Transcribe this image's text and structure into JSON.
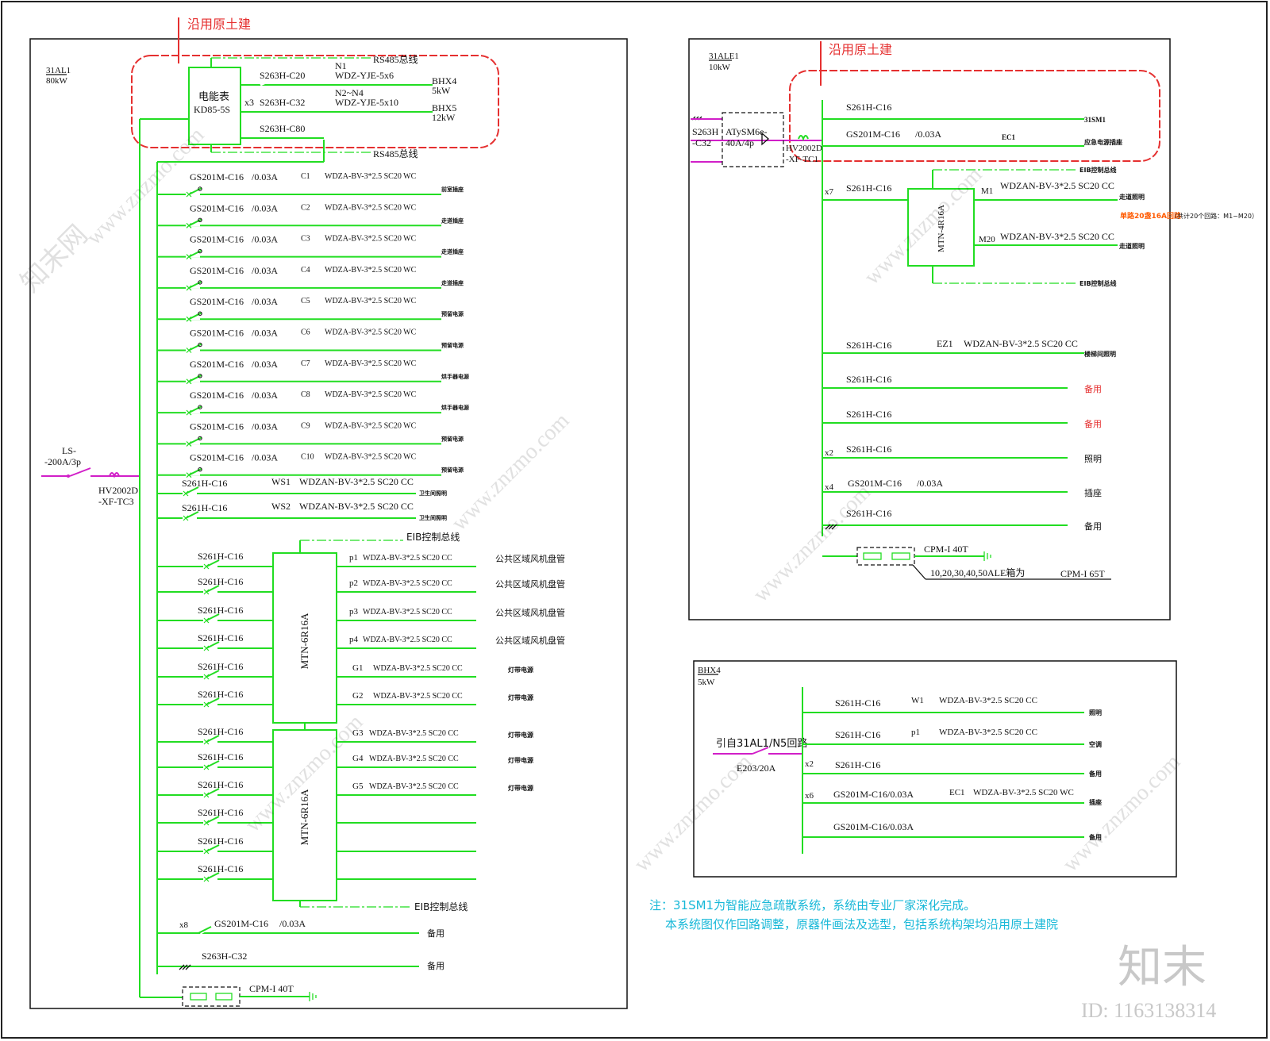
{
  "colors": {
    "bus": "#22dd22",
    "incoming": "#d11fc8",
    "cloud": "#e53030",
    "note": "#18b8d8",
    "orange": "#ff5a00"
  },
  "common": {
    "bus_left": "沿用原土建",
    "spare": "备用"
  },
  "panel1": {
    "name": "31AL1",
    "power": "80kW",
    "meter": "电能表",
    "meter_model": "KD85-5S",
    "x3": "x3",
    "rs485": "RS485总线",
    "top_circuits": [
      {
        "breaker": "S263H-C20",
        "id": "N1",
        "cable": "WDZ-YJE-5x6",
        "dest": "BHX4",
        "dest_kw": "5kW"
      },
      {
        "breaker": "S263H-C32",
        "id": "N2~N4",
        "cable": "WDZ-YJE-5x10",
        "dest": "BHX5",
        "dest_kw": "12kW"
      },
      {
        "breaker": "S263H-C80"
      }
    ],
    "circuits": [
      {
        "breaker": "GS201M-C16",
        "rcd": "/0.03A",
        "id": "C1",
        "cable": "WDZA-BV-3*2.5 SC20 WC",
        "dest": "前室插座"
      },
      {
        "breaker": "GS201M-C16",
        "rcd": "/0.03A",
        "id": "C2",
        "cable": "WDZA-BV-3*2.5 SC20 WC",
        "dest": "走道插座"
      },
      {
        "breaker": "GS201M-C16",
        "rcd": "/0.03A",
        "id": "C3",
        "cable": "WDZA-BV-3*2.5 SC20 WC",
        "dest": "走道插座"
      },
      {
        "breaker": "GS201M-C16",
        "rcd": "/0.03A",
        "id": "C4",
        "cable": "WDZA-BV-3*2.5 SC20 WC",
        "dest": "走道插座"
      },
      {
        "breaker": "GS201M-C16",
        "rcd": "/0.03A",
        "id": "C5",
        "cable": "WDZA-BV-3*2.5 SC20 WC",
        "dest": "预留电源"
      },
      {
        "breaker": "GS201M-C16",
        "rcd": "/0.03A",
        "id": "C6",
        "cable": "WDZA-BV-3*2.5 SC20 WC",
        "dest": "预留电源"
      },
      {
        "breaker": "GS201M-C16",
        "rcd": "/0.03A",
        "id": "C7",
        "cable": "WDZA-BV-3*2.5 SC20 WC",
        "dest": "烘手器电源"
      },
      {
        "breaker": "GS201M-C16",
        "rcd": "/0.03A",
        "id": "C8",
        "cable": "WDZA-BV-3*2.5 SC20 WC",
        "dest": "烘手器电源"
      },
      {
        "breaker": "GS201M-C16",
        "rcd": "/0.03A",
        "id": "C9",
        "cable": "WDZA-BV-3*2.5 SC20 WC",
        "dest": "预留电源"
      },
      {
        "breaker": "GS201M-C16",
        "rcd": "/0.03A",
        "id": "C10",
        "cable": "WDZA-BV-3*2.5 SC20 WC",
        "dest": "预留电源"
      }
    ],
    "ws": [
      {
        "breaker": "S261H-C16",
        "id": "WS1",
        "cable": "WDZAN-BV-3*2.5 SC20 CC",
        "dest": "卫生间照明"
      },
      {
        "breaker": "S261H-C16",
        "id": "WS2",
        "cable": "WDZAN-BV-3*2.5 SC20 CC",
        "dest": "卫生间照明"
      }
    ],
    "eib": "EIB控制总线",
    "module": "MTN-6R16A",
    "m_breaker": "S261H-C16",
    "mtn_out": [
      {
        "id": "p1",
        "cable": "WDZA-BV-3*2.5 SC20 CC",
        "dest": "公共区域风机盘管"
      },
      {
        "id": "p2",
        "cable": "WDZA-BV-3*2.5 SC20 CC",
        "dest": "公共区域风机盘管"
      },
      {
        "id": "p3",
        "cable": "WDZA-BV-3*2.5 SC20 CC",
        "dest": "公共区域风机盘管"
      },
      {
        "id": "p4",
        "cable": "WDZA-BV-3*2.5 SC20 CC",
        "dest": "公共区域风机盘管"
      },
      {
        "id": "G1",
        "cable": "WDZA-BV-3*2.5 SC20 CC",
        "dest": "灯带电源"
      },
      {
        "id": "G2",
        "cable": "WDZA-BV-3*2.5 SC20 CC",
        "dest": "灯带电源"
      },
      {
        "id": "G3",
        "cable": "WDZA-BV-3*2.5 SC20 CC",
        "dest": "灯带电源"
      },
      {
        "id": "G4",
        "cable": "WDZA-BV-3*2.5 SC20 CC",
        "dest": "灯带电源"
      },
      {
        "id": "G5",
        "cable": "WDZA-BV-3*2.5 SC20 CC",
        "dest": "灯带电源"
      }
    ],
    "x8": "x8",
    "spare1_breaker": "GS201M-C16",
    "spare1_rcd": "/0.03A",
    "spare2_breaker": "S263H-C32",
    "spd": "CPM-I 40T",
    "main_breaker": "LS-",
    "main_breaker2": "-200A/3p",
    "isolator": "HV2002D",
    "isolator2": "-XF-TC3"
  },
  "panel2": {
    "name": "31ALE1",
    "power": "10kW",
    "in_breaker": "S263H",
    "in_breaker2": "-C32",
    "ats": "ATySM6e-",
    "ats2": "40A/4p",
    "isolator": "HV2002D",
    "isolator2": "-XF-TC1",
    "sm_breaker": "S261H-C16",
    "sm_id": "31SM1",
    "ec_breaker": "GS201M-C16",
    "ec_rcd": "/0.03A",
    "ec_id": "EC1",
    "ec_dest": "应急电源插座",
    "x7": "x7",
    "m_breaker": "S261H-C16",
    "module": "MTN-4R16A",
    "eib_top": "EIB控制总线",
    "eib_bottom": "EIB控制总线",
    "m1_id": "M1",
    "m1_cable": "WDZAN-BV-3*2.5 SC20 CC",
    "m1_dest": "走道照明",
    "m20_id": "M20",
    "m20_cable": "WDZAN-BV-3*2.5 SC20 CC",
    "m20_dest": "走道照明",
    "note_red": "单路20盏16A回路",
    "note_black": "（共计20个回路：M1~M20）",
    "ez_breaker": "S261H-C16",
    "ez_id": "EZ1",
    "ez_cable": "WDZAN-BV-3*2.5 SC20 CC",
    "ez_dest": "楼梯间照明",
    "s1_breaker": "S261H-C16",
    "s2_breaker": "S261H-C16",
    "x2": "x2",
    "l_breaker": "S261H-C16",
    "l_dest": "照明",
    "x4": "x4",
    "p_breaker": "GS201M-C16",
    "p_rcd": "/0.03A",
    "p_dest": "插座",
    "s3_breaker": "S261H-C16",
    "spd": "CPM-I 40T",
    "spd_note": "10,20,30,40,50ALE箱为",
    "spd_note2": "CPM-I 65T"
  },
  "panel3": {
    "name": "BHX4",
    "power": "5kW",
    "from": "引自31AL1/N5回路",
    "from_breaker": "E203/20A",
    "w1_breaker": "S261H-C16",
    "w1_id": "W1",
    "w1_cable": "WDZA-BV-3*2.5 SC20 CC",
    "w1_dest": "照明",
    "p1_breaker": "S261H-C16",
    "p1_id": "p1",
    "p1_cable": "WDZA-BV-3*2.5 SC20 CC",
    "p1_dest": "空调",
    "x2": "x2",
    "s_breaker": "S261H-C16",
    "x6": "x6",
    "ec_breaker": "GS201M-C16/0.03A",
    "ec_id": "EC1",
    "ec_cable": "WDZA-BV-3*2.5 SC20 WC",
    "ec_dest": "插座",
    "s2_breaker": "GS201M-C16/0.03A"
  },
  "note": {
    "line1": "注：31SM1为智能应急疏散系统，系统由专业厂家深化完成。",
    "line2": "本系统图仅作回路调整，原器件画法及选型，包括系统构架均沿用原土建院"
  },
  "watermark": {
    "site": "www.znzmo.com",
    "brand": "知末网",
    "logo": "知末",
    "id": "ID: 1163138314"
  }
}
